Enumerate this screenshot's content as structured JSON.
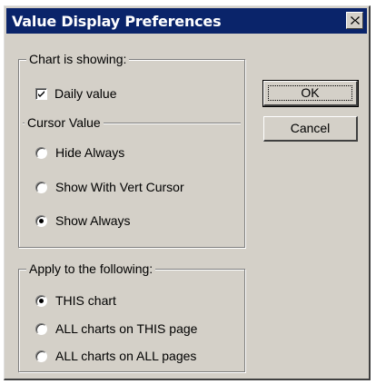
{
  "window": {
    "title": "Value Display Preferences"
  },
  "chart_group": {
    "legend": "Chart is showing:",
    "daily_value": {
      "label": "Daily value",
      "checked": true
    }
  },
  "cursor_group": {
    "legend": "Cursor Value",
    "options": [
      {
        "label": "Hide Always",
        "selected": false
      },
      {
        "label": "Show With Vert Cursor",
        "selected": false
      },
      {
        "label": "Show Always",
        "selected": true
      }
    ]
  },
  "apply_group": {
    "legend": "Apply to the following:",
    "options": [
      {
        "label": "THIS chart",
        "selected": true
      },
      {
        "label": "ALL charts on THIS page",
        "selected": false
      },
      {
        "label": "ALL charts on ALL pages",
        "selected": false
      }
    ]
  },
  "buttons": {
    "ok": "OK",
    "cancel": "Cancel"
  },
  "icons": {
    "close": "close-icon",
    "check": "checkmark-icon"
  },
  "colors": {
    "titlebar": "#0a246a",
    "face": "#d4d0c8"
  }
}
